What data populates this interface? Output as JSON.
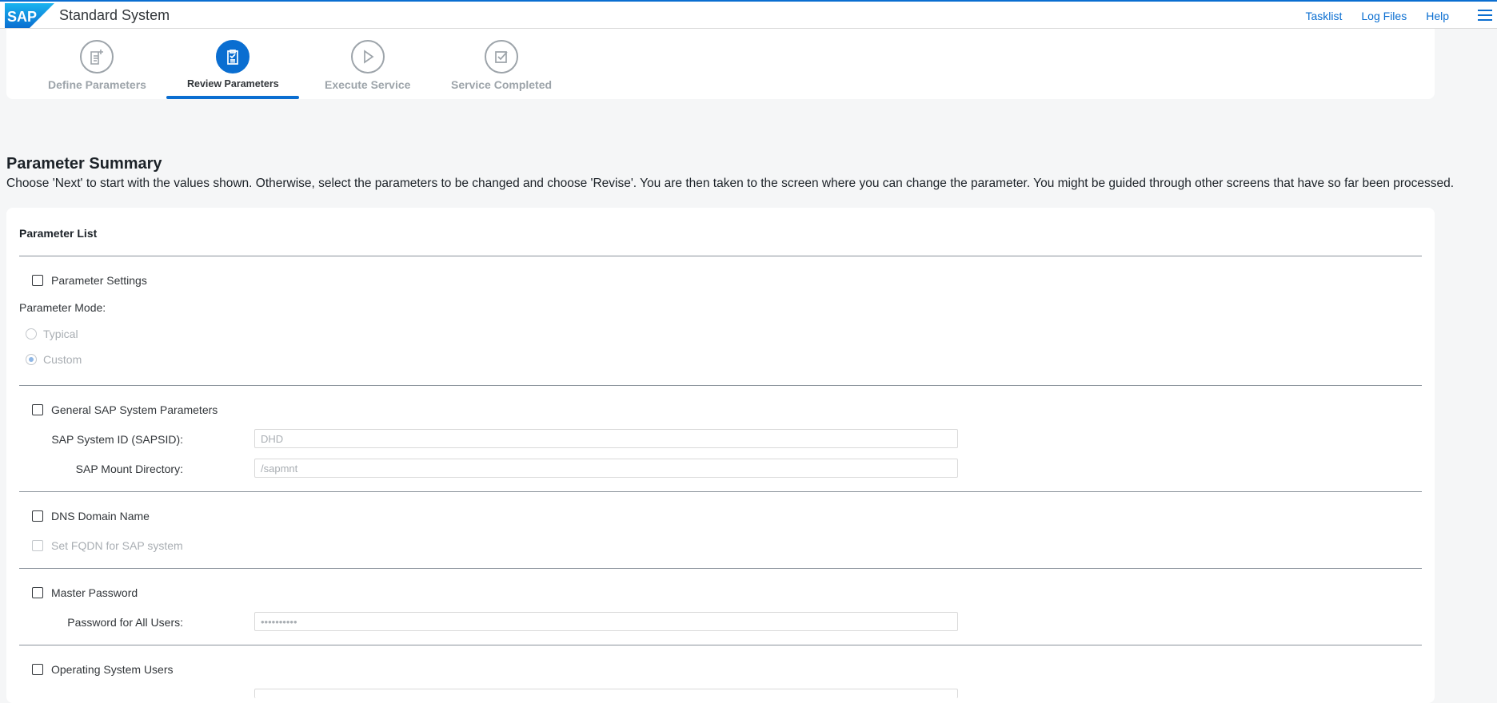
{
  "shell": {
    "logo_text": "SAP",
    "title": "Standard System",
    "links": [
      "Tasklist",
      "Log Files",
      "Help"
    ],
    "menu_icon": "hamburger-menu-icon"
  },
  "wizard": {
    "steps": [
      {
        "label": "Define Parameters",
        "icon": "document-add-icon",
        "active": false
      },
      {
        "label": "Review Parameters",
        "icon": "clipboard-check-icon",
        "active": true
      },
      {
        "label": "Execute Service",
        "icon": "play-icon",
        "active": false
      },
      {
        "label": "Service Completed",
        "icon": "checkbox-done-icon",
        "active": false
      }
    ]
  },
  "summary": {
    "title": "Parameter Summary",
    "description": "Choose 'Next' to start with the values shown. Otherwise, select the parameters to be changed and choose 'Revise'. You are then taken to the screen where you can change the parameter. You might be guided through other screens that have so far been processed."
  },
  "parameter_list": {
    "title": "Parameter List",
    "sections": {
      "parameter_settings": {
        "checkbox_label": "Parameter Settings",
        "mode_label": "Parameter Mode:",
        "options": [
          "Typical",
          "Custom"
        ],
        "selected": "Custom"
      },
      "general": {
        "checkbox_label": "General SAP System Parameters",
        "sapsid_label": "SAP System ID (SAPSID):",
        "sapsid_value": "DHD",
        "mount_label": "SAP Mount Directory:",
        "mount_value": "/sapmnt"
      },
      "dns": {
        "checkbox_label": "DNS Domain Name",
        "fqdn_label": "Set FQDN for SAP system"
      },
      "master_password": {
        "checkbox_label": "Master Password",
        "password_label": "Password for All Users:",
        "password_value": "••••••••••"
      },
      "os_users": {
        "checkbox_label": "Operating System Users"
      }
    }
  }
}
